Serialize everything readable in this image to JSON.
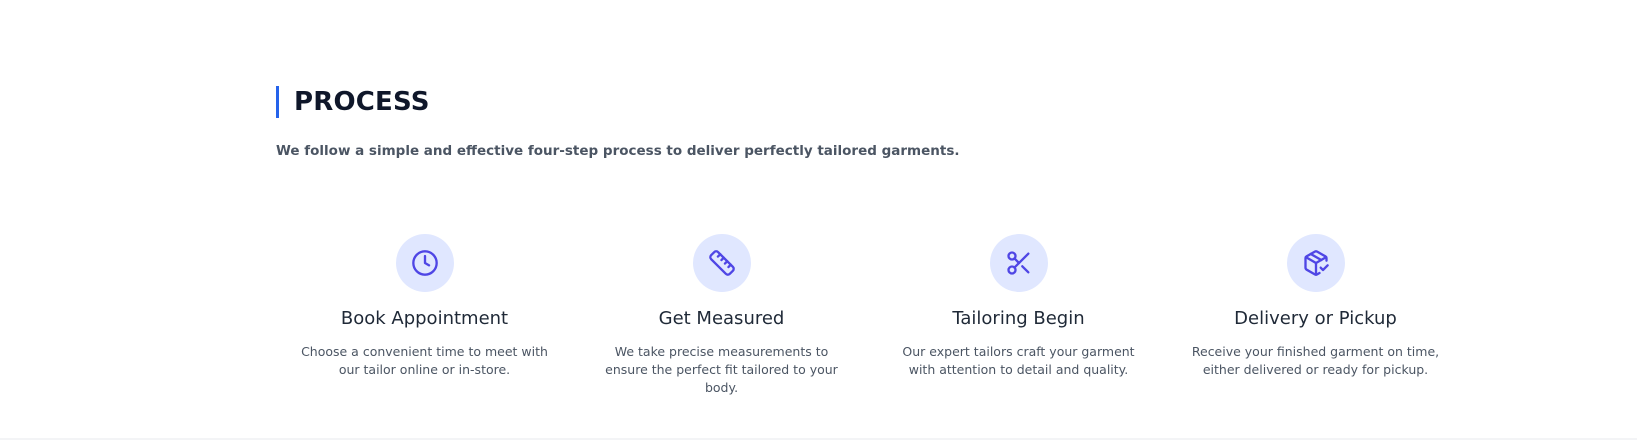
{
  "process": {
    "heading": "PROCESS",
    "subtitle": "We follow a simple and effective four-step process to deliver perfectly tailored garments.",
    "accent_color": "#2563eb",
    "icon_color": "#4f46e5",
    "icon_bg_color": "#e0e7ff",
    "steps": [
      {
        "icon": "clock-icon",
        "title": "Book Appointment",
        "description": "Choose a convenient time to meet with our tailor online or in-store."
      },
      {
        "icon": "ruler-icon",
        "title": "Get Measured",
        "description": "We take precise measurements to ensure the perfect fit tailored to your body."
      },
      {
        "icon": "scissors-icon",
        "title": "Tailoring Begin",
        "description": "Our expert tailors craft your garment with attention to detail and quality."
      },
      {
        "icon": "package-check-icon",
        "title": "Delivery or Pickup",
        "description": "Receive your finished garment on time, either delivered or ready for pickup."
      }
    ]
  }
}
